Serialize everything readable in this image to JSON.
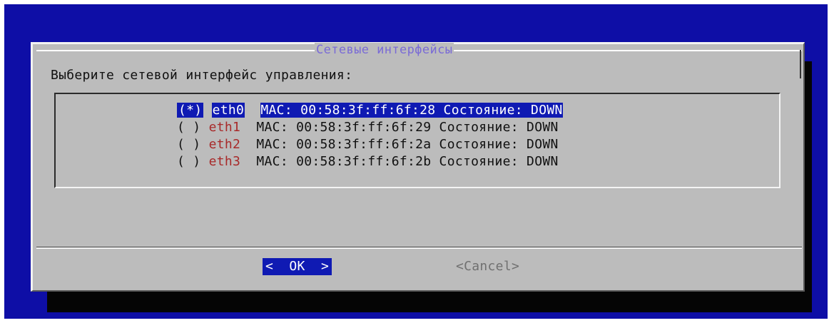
{
  "dialog": {
    "title": "Сетевые интерфейсы",
    "prompt": "Выберите сетевой интерфейс управления:"
  },
  "interfaces": [
    {
      "radio": "(*)",
      "name": "eth0",
      "description": "MAC: 00:58:3f:ff:6f:28 Состояние: DOWN",
      "selected": true
    },
    {
      "radio": "( )",
      "name": "eth1",
      "description": "MAC: 00:58:3f:ff:6f:29 Состояние: DOWN",
      "selected": false
    },
    {
      "radio": "( )",
      "name": "eth2",
      "description": "MAC: 00:58:3f:ff:6f:2a Состояние: DOWN",
      "selected": false
    },
    {
      "radio": "( )",
      "name": "eth3",
      "description": "MAC: 00:58:3f:ff:6f:2b Состояние: DOWN",
      "selected": false
    }
  ],
  "buttons": {
    "ok_label": "<  OK  >",
    "cancel_label": "<Cancel>"
  },
  "colors": {
    "background": "#0e0ea6",
    "dialog": "#bcbcbc",
    "highlight": "#0f1ab3",
    "title": "#7a6bd6",
    "interface_name": "#a82a2a"
  }
}
